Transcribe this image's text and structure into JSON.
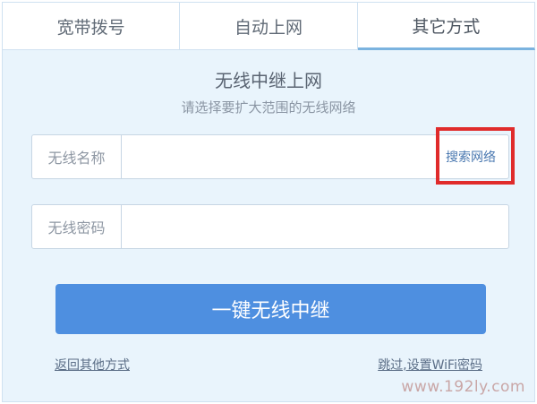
{
  "tabs": [
    {
      "label": "宽带拨号"
    },
    {
      "label": "自动上网"
    },
    {
      "label": "其它方式"
    }
  ],
  "active_tab": "其它方式",
  "panel": {
    "title": "无线中继上网",
    "subtitle": "请选择要扩大范围的无线网络"
  },
  "fields": {
    "ssid": {
      "label": "无线名称",
      "value": "",
      "placeholder": ""
    },
    "password": {
      "label": "无线密码",
      "value": "",
      "placeholder": ""
    }
  },
  "search_link": "搜索网络",
  "primary_button": "一键无线中继",
  "links": {
    "back": "返回其他方式",
    "skip": "跳过,设置WiFi密码"
  },
  "watermark": "www.192ly.com",
  "colors": {
    "accent": "#4e8fe0",
    "panel_bg": "#e9f4fc",
    "highlight": "#e02b2b"
  }
}
